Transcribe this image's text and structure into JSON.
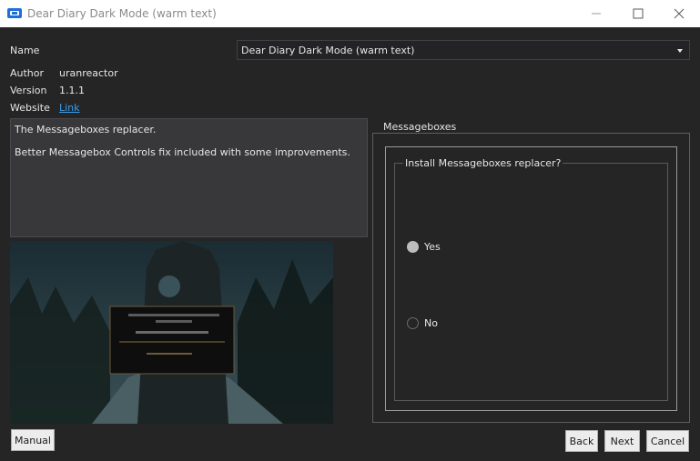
{
  "window": {
    "title": "Dear Diary Dark Mode (warm text)",
    "minimize_glyph": "—",
    "maximize_glyph": "☐",
    "close_glyph": "✕"
  },
  "info": {
    "name_label": "Name",
    "name_value": "Dear Diary Dark Mode (warm text)",
    "author_label": "Author",
    "author_value": "uranreactor",
    "version_label": "Version",
    "version_value": "1.1.1",
    "website_label": "Website",
    "website_link": "Link"
  },
  "description": {
    "line1": "The Messageboxes replacer.",
    "line2": "Better Messagebox Controls fix included with some improvements."
  },
  "step": {
    "group_title": "Messageboxes",
    "question": "Install Messageboxes replacer?",
    "options": [
      {
        "label": "Yes",
        "selected": true
      },
      {
        "label": "No",
        "selected": false
      }
    ]
  },
  "buttons": {
    "manual": "Manual",
    "back": "Back",
    "next": "Next",
    "cancel": "Cancel"
  },
  "colors": {
    "background": "#252526",
    "link": "#3a9ee8",
    "button_bg": "#ececec"
  }
}
